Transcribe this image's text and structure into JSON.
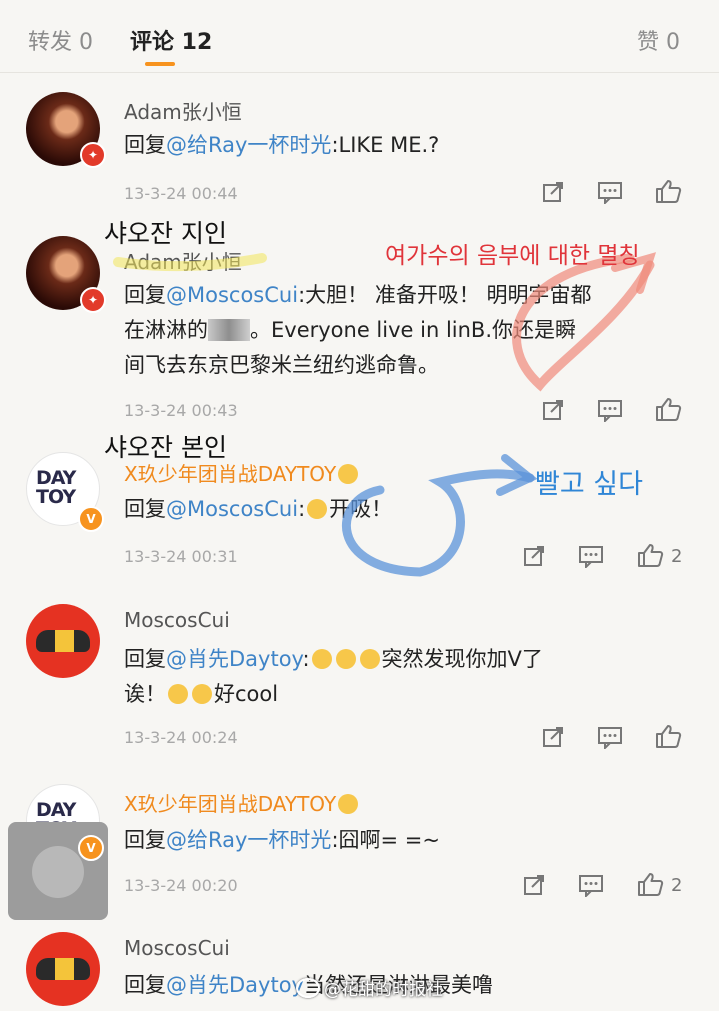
{
  "tabs": {
    "repost": "转发 0",
    "comments": "评论 12",
    "likes": "赞 0"
  },
  "comments": [
    {
      "user": "Adam张小恒",
      "prefix": "回复",
      "mention": "@给Ray一杯时光",
      "text": ":LIKE ME.?",
      "time": "13-3-24 00:44",
      "likes": ""
    },
    {
      "user": "Adam张小恒",
      "prefix": "回复",
      "mention": "@MoscosCui",
      "line1": ":大胆！ 准备开吸！ 明明宇宙都",
      "line2a": "在淋淋的",
      "line2b": "。Everyone live in linB.你还是瞬",
      "line3": "间飞去东京巴黎米兰纽约逃命鲁。",
      "time": "13-3-24 00:43",
      "likes": ""
    },
    {
      "user": "X玖少年团肖战DAYTOY",
      "prefix": "回复",
      "mention": "@MoscosCui",
      "text": "开吸！",
      "time": "13-3-24 00:31",
      "likes": "2"
    },
    {
      "user": "MoscosCui",
      "prefix": "回复",
      "mention": "@肖先Daytoy",
      "line1": "突然发现你加V了",
      "line2a": "诶！",
      "line2b": "好cool",
      "time": "13-3-24 00:24",
      "likes": ""
    },
    {
      "user": "X玖少年团肖战DAYTOY",
      "prefix": "回复",
      "mention": "@给Ray一杯时光",
      "text": ":囧啊= =~",
      "time": "13-3-24 00:20",
      "likes": "2"
    },
    {
      "user": "MoscosCui",
      "prefix": "回复",
      "mention": "@肖先Daytoy",
      "text": "当然还是淋淋最美噜",
      "time": "",
      "likes": ""
    }
  ],
  "annotations": {
    "friend": "샤오잔 지인",
    "nickname": "여가수의 음부에 대한 멸칭",
    "self": "샤오잔 본인",
    "want": "빨고 싶다"
  },
  "avatars": {
    "daytoy_logo_line1": "DAY",
    "daytoy_logo_line2": "TOY",
    "verified_badge": "V"
  },
  "watermark": "@花甜的时报社",
  "colors": {
    "accent": "#f7931e",
    "mention": "#3f84c7",
    "annotation_red": "#e0343a",
    "annotation_blue": "#2f86d6"
  }
}
